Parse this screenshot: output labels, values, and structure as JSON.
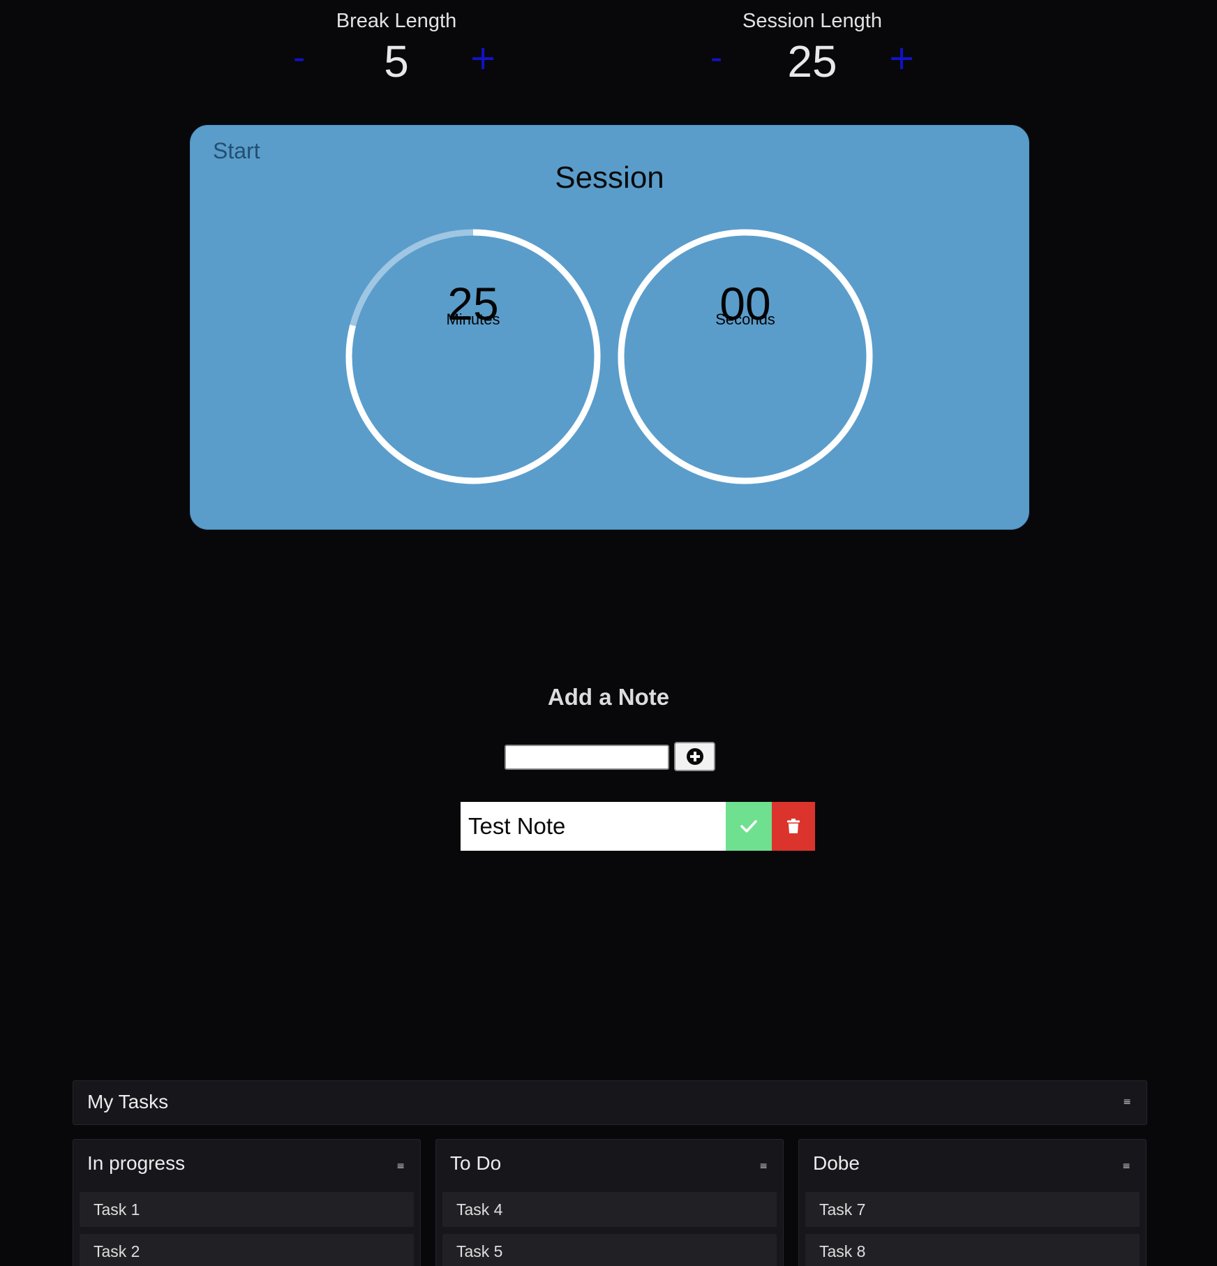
{
  "break": {
    "label": "Break Length",
    "value": "5",
    "minus": "-",
    "plus": "+"
  },
  "session": {
    "label": "Session Length",
    "value": "25",
    "minus": "-",
    "plus": "+"
  },
  "timer": {
    "start_label": "Start",
    "mode": "Session",
    "minutes": "25",
    "minutes_unit": "Minutes",
    "seconds": "00",
    "seconds_unit": "Seconds",
    "minutes_progress": 0.79,
    "seconds_progress": 1.0,
    "accent": "#5a9dcb"
  },
  "notes": {
    "heading": "Add a Note",
    "input_value": "",
    "add_icon": "plus-circle-icon",
    "items": [
      {
        "text": "Test Note",
        "done_icon": "check-icon",
        "delete_icon": "trash-icon"
      }
    ],
    "done_color": "#6fe08f",
    "delete_color": "#db342c"
  },
  "board": {
    "title": "My Tasks",
    "menu": "≡",
    "columns": [
      {
        "title": "In progress",
        "menu": "≡",
        "tasks": [
          "Task 1",
          "Task 2"
        ]
      },
      {
        "title": "To Do",
        "menu": "≡",
        "tasks": [
          "Task 4",
          "Task 5"
        ]
      },
      {
        "title": "Dobe",
        "menu": "≡",
        "tasks": [
          "Task 7",
          "Task 8"
        ]
      }
    ]
  }
}
